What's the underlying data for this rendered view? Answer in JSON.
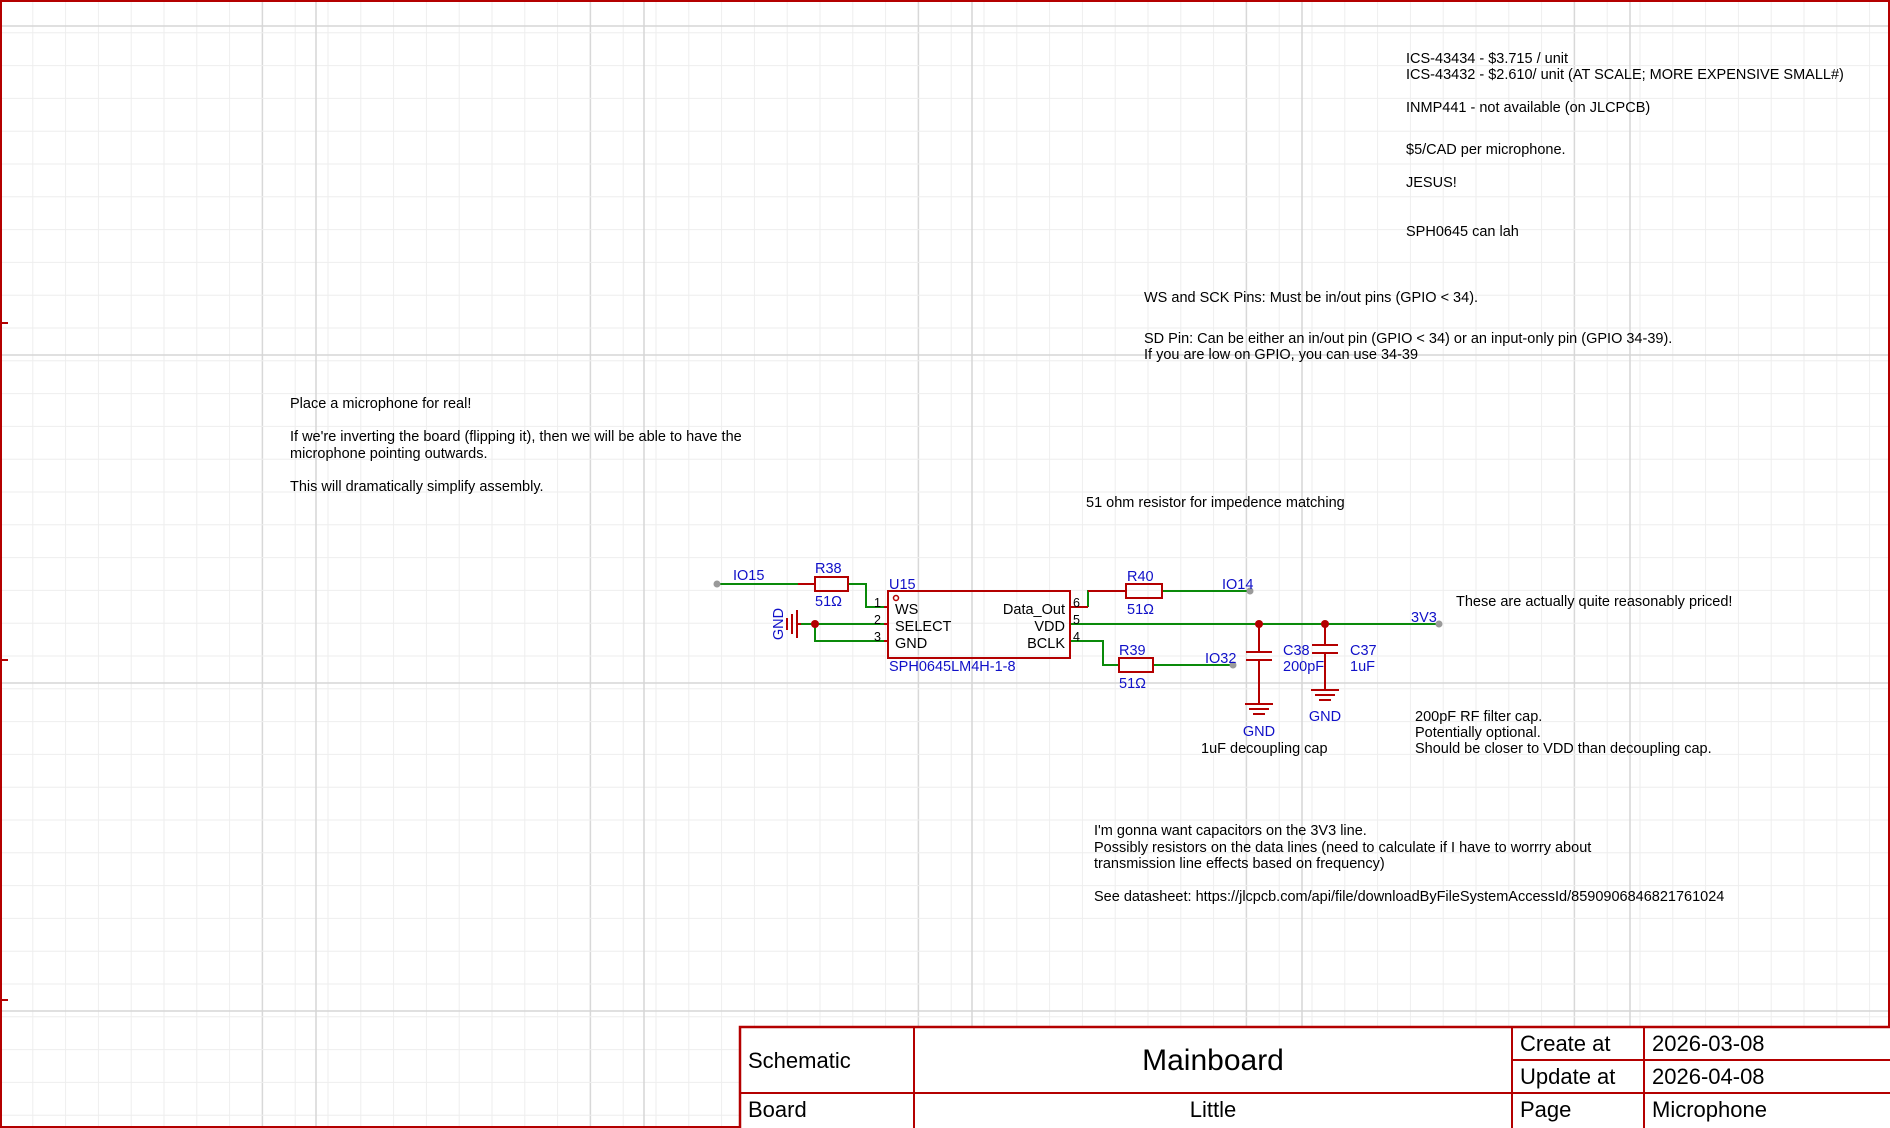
{
  "notes": {
    "ics_line1": "ICS-43434 - $3.715 / unit",
    "ics_line2": "ICS-43432 - $2.610/ unit (AT SCALE; MORE EXPENSIVE SMALL#)",
    "inmp": "INMP441 - not available (on JLCPCB)",
    "price_cad": "$5/CAD per microphone.",
    "jesus": "JESUS!",
    "sph_can": "SPH0645 can lah",
    "ws_sck": "WS and SCK Pins: Must be in/out pins (GPIO < 34).",
    "sd_line1": "SD Pin: Can be either an in/out pin (GPIO < 34) or an input-only pin (GPIO 34-39).",
    "sd_line2": "If you are low on GPIO, you can use 34-39",
    "place_mic": "Place a microphone for real!",
    "invert_line1": "If we're inverting the board (flipping it), then we will be able to have the",
    "invert_line2": "microphone pointing outwards.",
    "simplify": "This will dramatically simplify assembly.",
    "ohm_match": "51 ohm resistor for impedence matching",
    "reasonable": "These are actually quite reasonably priced!",
    "filter_line1": "200pF RF filter cap.",
    "filter_line2": "Potentially optional.",
    "filter_line3": "Should be closer to VDD than decoupling cap.",
    "decoupling": "1uF decoupling cap",
    "caps_line1": "I'm gonna want capacitors on the 3V3 line.",
    "caps_line2": "Possibly resistors on the data lines (need to calculate if I have to worrry about",
    "caps_line3": "transmission line effects based on frequency)",
    "datasheet": "See datasheet: https://jlcpcb.com/api/file/downloadByFileSystemAccessId/8590906846821761024"
  },
  "components": {
    "r38": {
      "ref": "R38",
      "value": "51Ω"
    },
    "r39": {
      "ref": "R39",
      "value": "51Ω"
    },
    "r40": {
      "ref": "R40",
      "value": "51Ω"
    },
    "c38": {
      "ref": "C38",
      "value": "200pF"
    },
    "c37": {
      "ref": "C37",
      "value": "1uF"
    },
    "u15": {
      "ref": "U15",
      "part": "SPH0645LM4H-1-8",
      "pins_left": [
        {
          "num": "1",
          "name": "WS"
        },
        {
          "num": "2",
          "name": "SELECT"
        },
        {
          "num": "3",
          "name": "GND"
        }
      ],
      "pins_right": [
        {
          "num": "6",
          "name": "Data_Out"
        },
        {
          "num": "5",
          "name": "VDD"
        },
        {
          "num": "4",
          "name": "BCLK"
        }
      ]
    }
  },
  "nets": {
    "io15": "IO15",
    "io14": "IO14",
    "io32": "IO32",
    "v3v3": "3V3",
    "gnd_left": "GND",
    "gnd_c38": "GND",
    "gnd_c37": "GND"
  },
  "title_block": {
    "type": "Schematic",
    "title": "Mainboard",
    "create_label": "Create at",
    "create_value": "2026-03-08",
    "update_label": "Update at",
    "update_value": "2026-04-08",
    "board_label": "Board",
    "board_value": "Little",
    "page_label": "Page",
    "page_value": "Microphone"
  },
  "colors": {
    "wire": "#0a8a0a",
    "component": "#b40000",
    "label": "#1010c8",
    "border": "#b40000"
  }
}
